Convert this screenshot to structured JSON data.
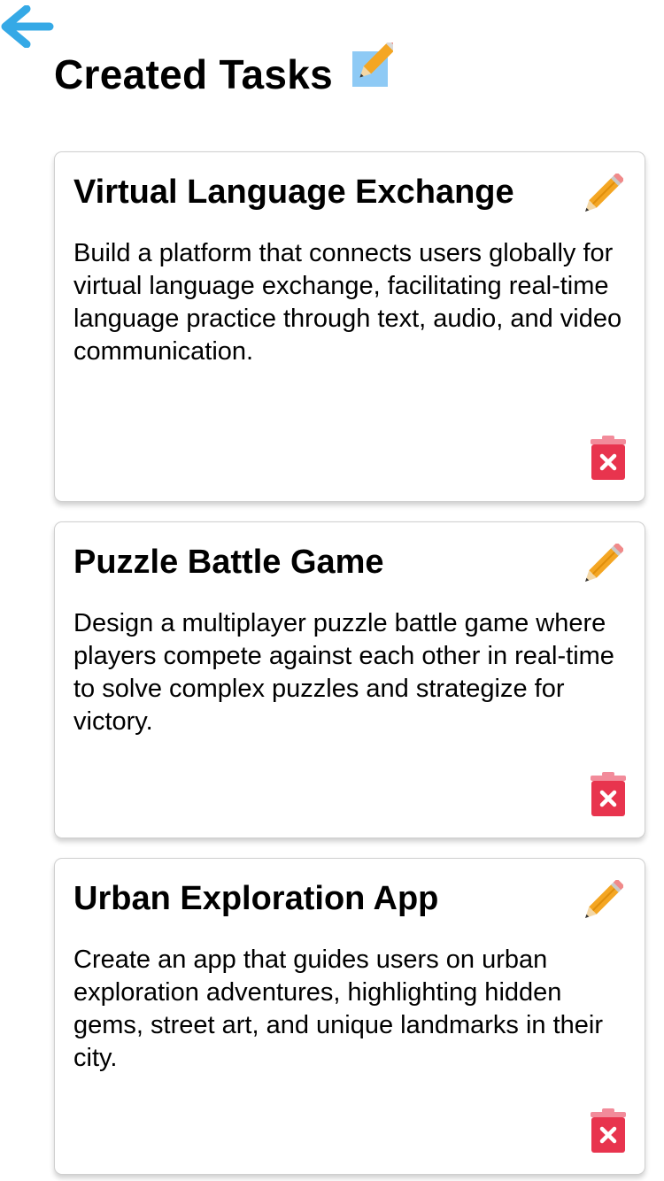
{
  "header": {
    "title": "Created Tasks",
    "back_icon": "left-arrow-icon",
    "title_icon": "memo-icon"
  },
  "colors": {
    "back_arrow": "#35a9e6",
    "pencil": "#f4a623",
    "trash": "#e8344e",
    "card_border": "#cfcfcf"
  },
  "tasks": [
    {
      "title": "Virtual Language Exchange",
      "description": "Build a platform that connects users globally for virtual language exchange, facilitating real-time language practice through text, audio, and video communication.",
      "edit_icon": "pencil-icon",
      "delete_icon": "trash-icon"
    },
    {
      "title": "Puzzle Battle Game",
      "description": "Design a multiplayer puzzle battle game where players compete against each other in real-time to solve complex puzzles and strategize for victory.",
      "edit_icon": "pencil-icon",
      "delete_icon": "trash-icon"
    },
    {
      "title": "Urban Exploration App",
      "description": "Create an app that guides users on urban exploration adventures, highlighting hidden gems, street art, and unique landmarks in their city.",
      "edit_icon": "pencil-icon",
      "delete_icon": "trash-icon"
    }
  ]
}
